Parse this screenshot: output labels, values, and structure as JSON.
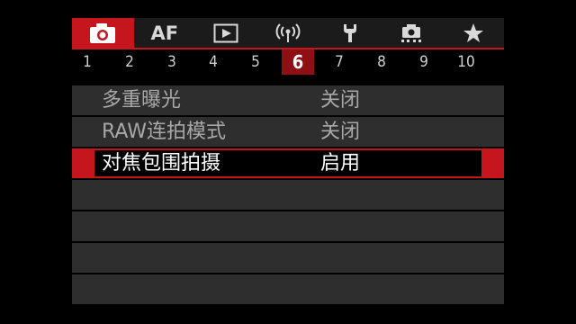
{
  "tabs": [
    {
      "name": "camera",
      "active": true
    },
    {
      "name": "af",
      "label": "AF"
    },
    {
      "name": "playback"
    },
    {
      "name": "wireless"
    },
    {
      "name": "setup"
    },
    {
      "name": "custom"
    },
    {
      "name": "my-menu"
    }
  ],
  "pages": [
    "1",
    "2",
    "3",
    "4",
    "5",
    "6",
    "7",
    "8",
    "9",
    "10"
  ],
  "active_page": "6",
  "menu": {
    "items": [
      {
        "label": "多重曝光",
        "value": "关闭"
      },
      {
        "label": "RAW连拍模式",
        "value": "关闭"
      },
      {
        "label": "对焦包围拍摄",
        "value": "启用",
        "selected": true
      }
    ]
  },
  "colors": {
    "accent": "#c4161c",
    "row_bg": "#2e2e2e",
    "text_dim": "#a8a8a8",
    "text_active": "#ffffff"
  }
}
